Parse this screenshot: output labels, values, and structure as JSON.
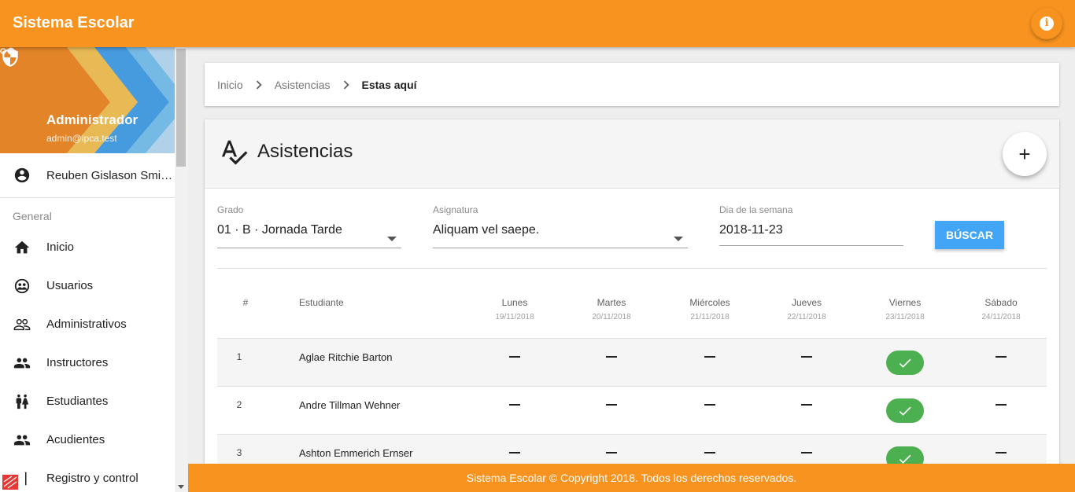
{
  "app": {
    "title": "Sistema Escolar"
  },
  "profile": {
    "name": "Administrador",
    "email": "admin@ipca.test"
  },
  "current_user": "Reuben Gislason Smi…",
  "nav": {
    "section": "General",
    "items": [
      {
        "label": "Inicio",
        "icon": "home-icon"
      },
      {
        "label": "Usuarios",
        "icon": "users-globe-icon"
      },
      {
        "label": "Administrativos",
        "icon": "people-outline-icon"
      },
      {
        "label": "Instructores",
        "icon": "people-icon"
      },
      {
        "label": "Estudiantes",
        "icon": "wc-icon"
      },
      {
        "label": "Acudientes",
        "icon": "people-icon"
      },
      {
        "label": "Registro y control",
        "icon": "bracket-icon"
      }
    ]
  },
  "breadcrumb": {
    "items": [
      "Inicio",
      "Asistencias"
    ],
    "current": "Estas aquí"
  },
  "page": {
    "title": "Asistencias"
  },
  "filters": {
    "grado": {
      "label": "Grado",
      "value": "01 · B · Jornada Tarde"
    },
    "asignatura": {
      "label": "Asignatura",
      "value": "Aliquam vel saepe."
    },
    "dia": {
      "label": "Dia de la semana",
      "value": "2018-11-23"
    },
    "search_button": "BÚSCAR"
  },
  "table": {
    "headers": {
      "num": "#",
      "student": "Estudiante"
    },
    "days": [
      {
        "name": "Lunes",
        "date": "19/11/2018"
      },
      {
        "name": "Martes",
        "date": "20/11/2018"
      },
      {
        "name": "Miércoles",
        "date": "21/11/2018"
      },
      {
        "name": "Jueves",
        "date": "22/11/2018"
      },
      {
        "name": "Viernes",
        "date": "23/11/2018"
      },
      {
        "name": "Sábado",
        "date": "24/11/2018"
      }
    ],
    "rows": [
      {
        "num": "1",
        "name": "Aglae Ritchie Barton",
        "attendance": [
          "none",
          "none",
          "none",
          "none",
          "present",
          "none"
        ]
      },
      {
        "num": "2",
        "name": "Andre Tillman Wehner",
        "attendance": [
          "none",
          "none",
          "none",
          "none",
          "present",
          "none"
        ]
      },
      {
        "num": "3",
        "name": "Ashton Emmerich Ernser",
        "attendance": [
          "none",
          "none",
          "none",
          "none",
          "present",
          "none"
        ]
      }
    ]
  },
  "footer": {
    "text": "Sistema Escolar © Copyright 2018. Todos los derechos reservados."
  },
  "colors": {
    "primary": "#f7931e",
    "accent": "#42a5f5",
    "present": "#4caf50"
  }
}
